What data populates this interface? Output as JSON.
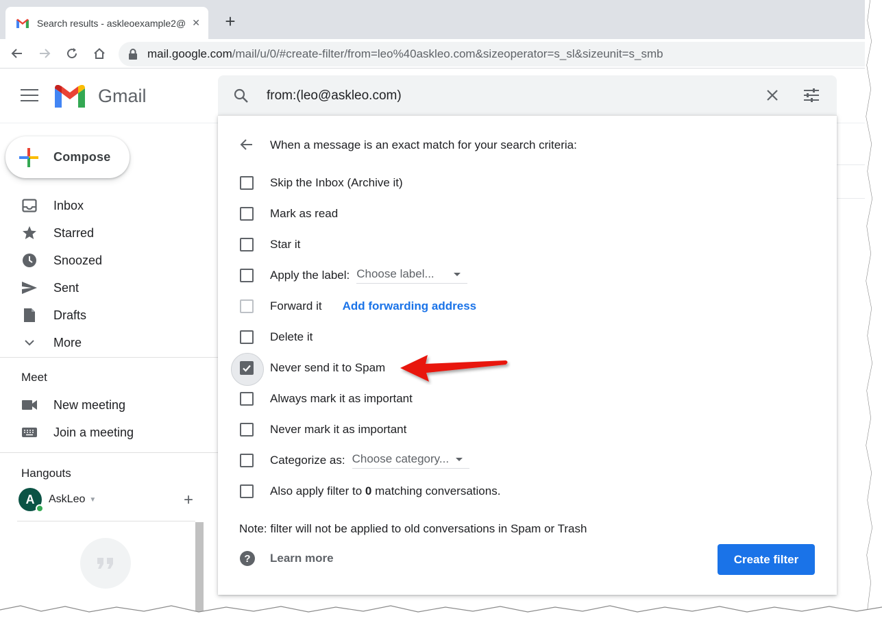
{
  "browser": {
    "tab_title": "Search results - askleoexample2@",
    "url_host": "mail.google.com",
    "url_path": "/mail/u/0/#create-filter/from=leo%40askleo.com&sizeoperator=s_sl&sizeunit=s_smb"
  },
  "gmail": {
    "brand": "Gmail",
    "search_query": "from:(leo@askleo.com)",
    "compose_label": "Compose"
  },
  "sidebar": {
    "items": [
      {
        "label": "Inbox",
        "icon": "inbox-icon"
      },
      {
        "label": "Starred",
        "icon": "star-icon"
      },
      {
        "label": "Snoozed",
        "icon": "clock-icon"
      },
      {
        "label": "Sent",
        "icon": "send-icon"
      },
      {
        "label": "Drafts",
        "icon": "drafts-icon"
      },
      {
        "label": "More",
        "icon": "chevron-down-icon"
      }
    ],
    "meet": {
      "title": "Meet",
      "new_meeting": "New meeting",
      "join_meeting": "Join a meeting"
    },
    "hangouts": {
      "title": "Hangouts",
      "user_initial": "A",
      "user_name": "AskLeo"
    }
  },
  "filter": {
    "header": "When a message is an exact match for your search criteria:",
    "options": {
      "skip_inbox": "Skip the Inbox (Archive it)",
      "mark_read": "Mark as read",
      "star_it": "Star it",
      "apply_label": "Apply the label:",
      "apply_label_select": "Choose label...",
      "forward_it": "Forward it",
      "forward_link": "Add forwarding address",
      "delete_it": "Delete it",
      "never_spam": "Never send it to Spam",
      "always_important": "Always mark it as important",
      "never_important": "Never mark it as important",
      "categorize": "Categorize as:",
      "categorize_select": "Choose category...",
      "also_apply_pre": "Also apply filter to ",
      "also_apply_count": "0",
      "also_apply_post": " matching conversations."
    },
    "checked": {
      "never_spam": true
    },
    "note": "Note: filter will not be applied to old conversations in Spam or Trash",
    "learn_more": "Learn more",
    "create_button": "Create filter"
  },
  "colors": {
    "accent_blue": "#1a73e8",
    "annotation_red": "#e8150b"
  }
}
